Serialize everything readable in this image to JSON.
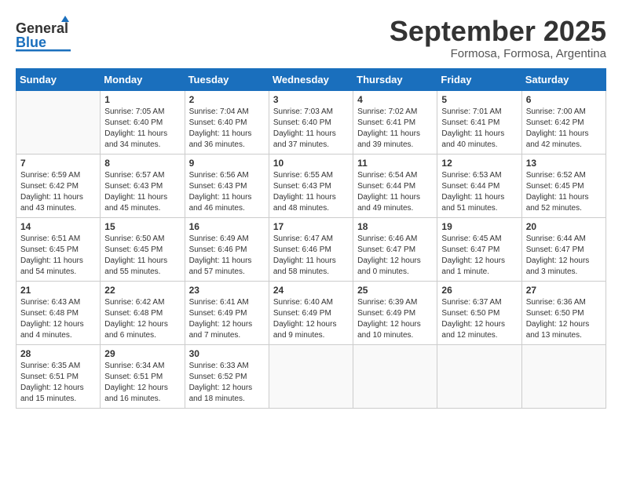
{
  "header": {
    "logo_general": "General",
    "logo_blue": "Blue",
    "month_title": "September 2025",
    "location": "Formosa, Formosa, Argentina"
  },
  "weekdays": [
    "Sunday",
    "Monday",
    "Tuesday",
    "Wednesday",
    "Thursday",
    "Friday",
    "Saturday"
  ],
  "weeks": [
    [
      {
        "day": "",
        "info": ""
      },
      {
        "day": "1",
        "info": "Sunrise: 7:05 AM\nSunset: 6:40 PM\nDaylight: 11 hours\nand 34 minutes."
      },
      {
        "day": "2",
        "info": "Sunrise: 7:04 AM\nSunset: 6:40 PM\nDaylight: 11 hours\nand 36 minutes."
      },
      {
        "day": "3",
        "info": "Sunrise: 7:03 AM\nSunset: 6:40 PM\nDaylight: 11 hours\nand 37 minutes."
      },
      {
        "day": "4",
        "info": "Sunrise: 7:02 AM\nSunset: 6:41 PM\nDaylight: 11 hours\nand 39 minutes."
      },
      {
        "day": "5",
        "info": "Sunrise: 7:01 AM\nSunset: 6:41 PM\nDaylight: 11 hours\nand 40 minutes."
      },
      {
        "day": "6",
        "info": "Sunrise: 7:00 AM\nSunset: 6:42 PM\nDaylight: 11 hours\nand 42 minutes."
      }
    ],
    [
      {
        "day": "7",
        "info": "Sunrise: 6:59 AM\nSunset: 6:42 PM\nDaylight: 11 hours\nand 43 minutes."
      },
      {
        "day": "8",
        "info": "Sunrise: 6:57 AM\nSunset: 6:43 PM\nDaylight: 11 hours\nand 45 minutes."
      },
      {
        "day": "9",
        "info": "Sunrise: 6:56 AM\nSunset: 6:43 PM\nDaylight: 11 hours\nand 46 minutes."
      },
      {
        "day": "10",
        "info": "Sunrise: 6:55 AM\nSunset: 6:43 PM\nDaylight: 11 hours\nand 48 minutes."
      },
      {
        "day": "11",
        "info": "Sunrise: 6:54 AM\nSunset: 6:44 PM\nDaylight: 11 hours\nand 49 minutes."
      },
      {
        "day": "12",
        "info": "Sunrise: 6:53 AM\nSunset: 6:44 PM\nDaylight: 11 hours\nand 51 minutes."
      },
      {
        "day": "13",
        "info": "Sunrise: 6:52 AM\nSunset: 6:45 PM\nDaylight: 11 hours\nand 52 minutes."
      }
    ],
    [
      {
        "day": "14",
        "info": "Sunrise: 6:51 AM\nSunset: 6:45 PM\nDaylight: 11 hours\nand 54 minutes."
      },
      {
        "day": "15",
        "info": "Sunrise: 6:50 AM\nSunset: 6:45 PM\nDaylight: 11 hours\nand 55 minutes."
      },
      {
        "day": "16",
        "info": "Sunrise: 6:49 AM\nSunset: 6:46 PM\nDaylight: 11 hours\nand 57 minutes."
      },
      {
        "day": "17",
        "info": "Sunrise: 6:47 AM\nSunset: 6:46 PM\nDaylight: 11 hours\nand 58 minutes."
      },
      {
        "day": "18",
        "info": "Sunrise: 6:46 AM\nSunset: 6:47 PM\nDaylight: 12 hours\nand 0 minutes."
      },
      {
        "day": "19",
        "info": "Sunrise: 6:45 AM\nSunset: 6:47 PM\nDaylight: 12 hours\nand 1 minute."
      },
      {
        "day": "20",
        "info": "Sunrise: 6:44 AM\nSunset: 6:47 PM\nDaylight: 12 hours\nand 3 minutes."
      }
    ],
    [
      {
        "day": "21",
        "info": "Sunrise: 6:43 AM\nSunset: 6:48 PM\nDaylight: 12 hours\nand 4 minutes."
      },
      {
        "day": "22",
        "info": "Sunrise: 6:42 AM\nSunset: 6:48 PM\nDaylight: 12 hours\nand 6 minutes."
      },
      {
        "day": "23",
        "info": "Sunrise: 6:41 AM\nSunset: 6:49 PM\nDaylight: 12 hours\nand 7 minutes."
      },
      {
        "day": "24",
        "info": "Sunrise: 6:40 AM\nSunset: 6:49 PM\nDaylight: 12 hours\nand 9 minutes."
      },
      {
        "day": "25",
        "info": "Sunrise: 6:39 AM\nSunset: 6:49 PM\nDaylight: 12 hours\nand 10 minutes."
      },
      {
        "day": "26",
        "info": "Sunrise: 6:37 AM\nSunset: 6:50 PM\nDaylight: 12 hours\nand 12 minutes."
      },
      {
        "day": "27",
        "info": "Sunrise: 6:36 AM\nSunset: 6:50 PM\nDaylight: 12 hours\nand 13 minutes."
      }
    ],
    [
      {
        "day": "28",
        "info": "Sunrise: 6:35 AM\nSunset: 6:51 PM\nDaylight: 12 hours\nand 15 minutes."
      },
      {
        "day": "29",
        "info": "Sunrise: 6:34 AM\nSunset: 6:51 PM\nDaylight: 12 hours\nand 16 minutes."
      },
      {
        "day": "30",
        "info": "Sunrise: 6:33 AM\nSunset: 6:52 PM\nDaylight: 12 hours\nand 18 minutes."
      },
      {
        "day": "",
        "info": ""
      },
      {
        "day": "",
        "info": ""
      },
      {
        "day": "",
        "info": ""
      },
      {
        "day": "",
        "info": ""
      }
    ]
  ]
}
